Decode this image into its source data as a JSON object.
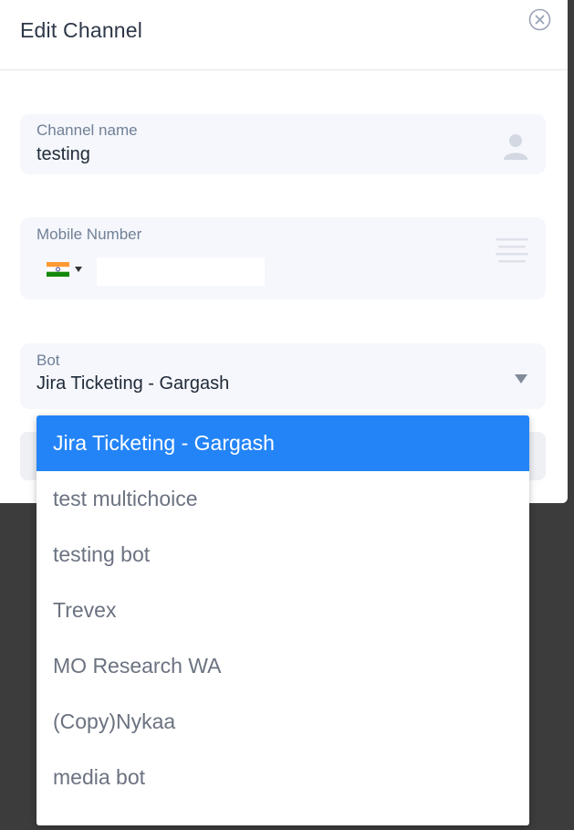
{
  "modal": {
    "title": "Edit Channel"
  },
  "channel_name": {
    "label": "Channel name",
    "value": "testing"
  },
  "mobile": {
    "label": "Mobile Number",
    "country_flag": "india-flag",
    "number": ""
  },
  "bot": {
    "label": "Bot",
    "selected": "Jira Ticketing - Gargash",
    "options": [
      "Jira Ticketing - Gargash",
      "test multichoice",
      "testing bot",
      "Trevex",
      "MO Research WA",
      "(Copy)Nykaa",
      "media bot"
    ]
  },
  "colors": {
    "selected_option": "#2384f7",
    "field_background": "#f5f7fc",
    "overlay": "#3c3c3c"
  },
  "icons": [
    "close-icon",
    "person-icon",
    "menu-icon",
    "chevron-down-icon",
    "india-flag"
  ]
}
